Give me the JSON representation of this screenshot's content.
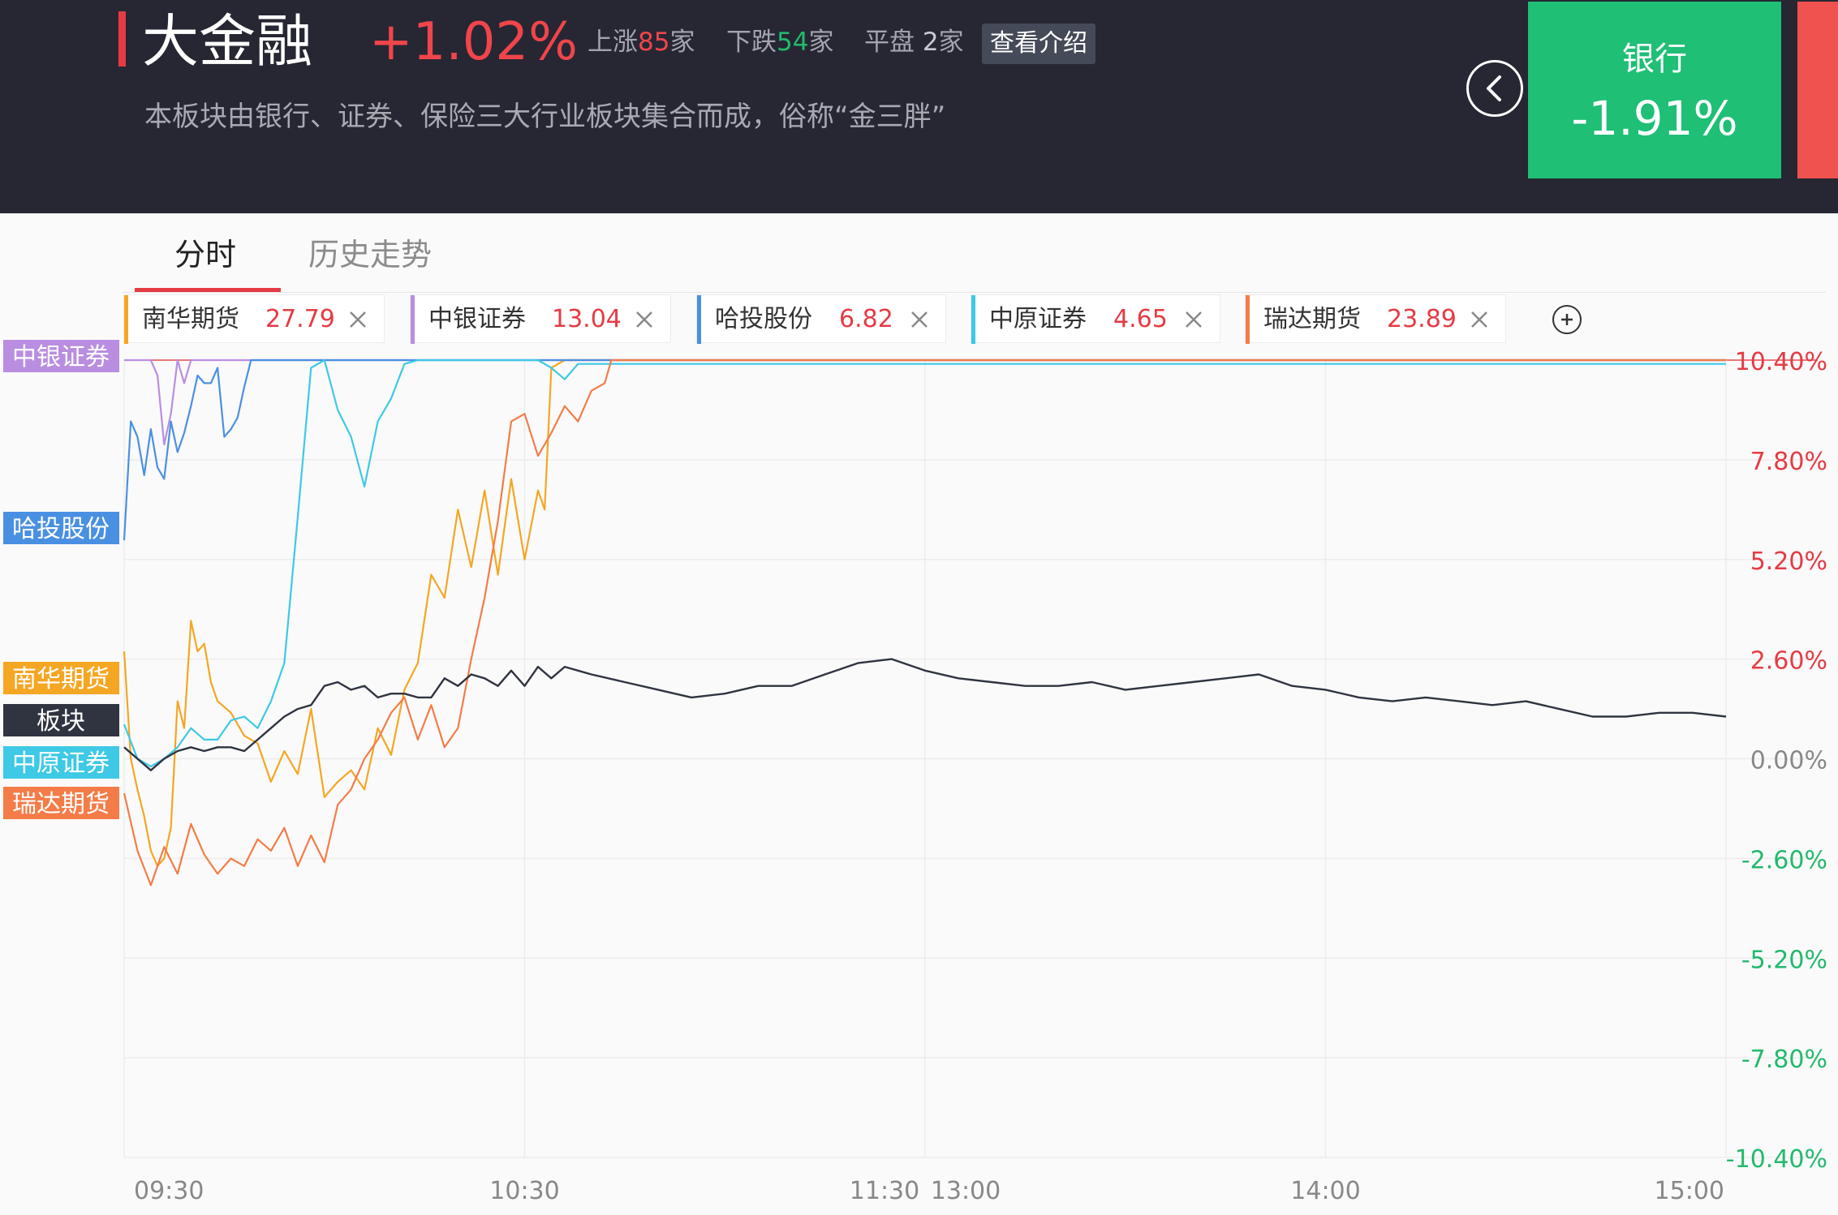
{
  "header": {
    "sector_name": "大金融",
    "sector_change": "+1.02%",
    "up_label": "上涨",
    "up_count": "85",
    "down_label": "下跌",
    "down_count": "54",
    "flat_label": "平盘",
    "flat_count": "2",
    "unit": "家",
    "intro_button": "查看介绍",
    "description": "本板块由银行、证券、保险三大行业板块集合而成，俗称“金三胖”"
  },
  "side_card": {
    "name": "银行",
    "change": "-1.91%"
  },
  "tabs": [
    {
      "label": "分时"
    },
    {
      "label": "历史走势"
    }
  ],
  "chips": [
    {
      "name": "南华期货",
      "value": "27.79",
      "color": "#f5a623"
    },
    {
      "name": "中银证券",
      "value": "13.04",
      "color": "#b98ee0"
    },
    {
      "name": "哈投股份",
      "value": "6.82",
      "color": "#4a90e2"
    },
    {
      "name": "中原证券",
      "value": "4.65",
      "color": "#3ec9e6"
    },
    {
      "name": "瑞达期货",
      "value": "23.89",
      "color": "#f47c48"
    }
  ],
  "colors": {
    "up": "#e53b44",
    "down": "#23b96d",
    "board": "#2f3440",
    "header_bg": "#262733"
  },
  "icons": {
    "back": "chevron-left-icon",
    "close": "close-icon",
    "add": "plus-circle-icon"
  },
  "chart_data": {
    "type": "line",
    "y_unit": "%",
    "ylim": [
      -10.4,
      10.4
    ],
    "y_ticks": [
      10.4,
      7.8,
      5.2,
      2.6,
      0.0,
      -2.6,
      -5.2,
      -7.8,
      -10.4
    ],
    "y_tick_labels": [
      "10.40%",
      "7.80%",
      "5.20%",
      "2.60%",
      "0.00%",
      "-2.60%",
      "-5.20%",
      "-7.80%",
      "-10.40%"
    ],
    "x_tick_labels": [
      "09:30",
      "10:30",
      "11:30",
      "13:00",
      "14:00",
      "15:00"
    ],
    "x_tick_minutes": [
      0,
      60,
      120,
      120,
      180,
      240
    ],
    "x_range": [
      0,
      240
    ],
    "grid": true,
    "series": [
      {
        "name": "南华期货",
        "color": "#f5a623",
        "x": [
          0,
          1,
          2,
          3,
          4,
          5,
          6,
          7,
          8,
          9,
          10,
          11,
          12,
          13,
          14,
          16,
          18,
          20,
          22,
          24,
          26,
          28,
          30,
          32,
          34,
          36,
          38,
          40,
          42,
          44,
          46,
          48,
          50,
          52,
          54,
          56,
          58,
          60,
          62,
          63,
          64,
          66,
          68,
          70,
          72,
          74,
          76,
          78,
          80,
          81,
          82,
          84,
          86,
          90,
          100,
          110,
          120,
          130,
          140,
          150,
          160,
          170,
          180,
          190,
          200,
          210,
          220,
          230,
          240
        ],
        "values": [
          2.8,
          0.0,
          -0.8,
          -1.5,
          -2.4,
          -2.8,
          -2.6,
          -1.8,
          1.5,
          0.8,
          3.6,
          2.8,
          3.0,
          2.0,
          1.5,
          1.2,
          0.6,
          0.4,
          -0.6,
          0.2,
          -0.4,
          1.3,
          -1.0,
          -0.6,
          -0.3,
          -0.8,
          0.8,
          0.1,
          1.8,
          2.5,
          4.8,
          4.2,
          6.5,
          5.0,
          7.0,
          4.8,
          7.3,
          5.2,
          7.0,
          6.5,
          10.2,
          10.4,
          10.4,
          10.4,
          10.4,
          10.4,
          10.4,
          10.4,
          10.4,
          10.4,
          10.4,
          10.4,
          10.4,
          10.4,
          10.4,
          10.4,
          10.4,
          10.4,
          10.4,
          10.4,
          10.4,
          10.4,
          10.4,
          10.4,
          10.4,
          10.4,
          10.4,
          10.4,
          10.4
        ]
      },
      {
        "name": "中银证券",
        "color": "#b98ee0",
        "x": [
          0,
          3,
          4,
          5,
          6,
          7,
          8,
          9,
          10,
          11,
          12,
          13,
          14,
          16,
          20,
          40,
          60,
          80,
          100,
          120,
          140,
          160,
          180,
          200,
          220,
          240
        ],
        "values": [
          10.4,
          10.4,
          10.4,
          10.0,
          8.2,
          9.0,
          10.4,
          9.8,
          10.4,
          10.4,
          10.4,
          10.4,
          10.4,
          10.4,
          10.4,
          10.4,
          10.4,
          10.4,
          10.4,
          10.4,
          10.4,
          10.4,
          10.4,
          10.4,
          10.4,
          10.4
        ]
      },
      {
        "name": "哈投股份",
        "color": "#4a90e2",
        "x": [
          0,
          1,
          2,
          3,
          4,
          5,
          6,
          7,
          8,
          9,
          10,
          11,
          12,
          13,
          14,
          15,
          16,
          17,
          18,
          19,
          20,
          30,
          60,
          90,
          120,
          150,
          180,
          210,
          240
        ],
        "values": [
          5.7,
          8.8,
          8.4,
          7.4,
          8.6,
          7.6,
          7.3,
          8.8,
          8.0,
          8.5,
          9.2,
          10.0,
          9.8,
          9.8,
          10.2,
          8.4,
          8.6,
          8.9,
          9.7,
          10.4,
          10.4,
          10.4,
          10.4,
          10.4,
          10.4,
          10.4,
          10.4,
          10.4,
          10.4
        ]
      },
      {
        "name": "中原证券",
        "color": "#3ec9e6",
        "x": [
          0,
          2,
          4,
          6,
          8,
          10,
          12,
          14,
          16,
          18,
          20,
          22,
          24,
          26,
          28,
          30,
          32,
          34,
          36,
          38,
          40,
          42,
          44,
          46,
          48,
          50,
          52,
          54,
          56,
          58,
          60,
          62,
          64,
          66,
          68,
          70,
          80,
          100,
          120,
          140,
          160,
          180,
          200,
          220,
          240
        ],
        "values": [
          0.9,
          0.0,
          -0.2,
          0.0,
          0.3,
          0.8,
          0.5,
          0.5,
          1.0,
          1.1,
          0.8,
          1.5,
          2.5,
          6.3,
          10.2,
          10.4,
          9.1,
          8.4,
          7.1,
          8.8,
          9.4,
          10.3,
          10.4,
          10.4,
          10.4,
          10.4,
          10.4,
          10.4,
          10.4,
          10.4,
          10.4,
          10.4,
          10.2,
          9.9,
          10.3,
          10.3,
          10.3,
          10.3,
          10.3,
          10.3,
          10.3,
          10.3,
          10.3,
          10.3,
          10.3
        ]
      },
      {
        "name": "瑞达期货",
        "color": "#f47c48",
        "x": [
          0,
          2,
          4,
          6,
          8,
          10,
          12,
          14,
          16,
          18,
          20,
          22,
          24,
          26,
          28,
          30,
          32,
          34,
          36,
          38,
          40,
          42,
          44,
          46,
          48,
          50,
          52,
          54,
          56,
          58,
          60,
          62,
          64,
          66,
          68,
          70,
          72,
          73,
          80,
          100,
          120,
          140,
          160,
          180,
          200,
          220,
          240
        ],
        "values": [
          -0.9,
          -2.4,
          -3.3,
          -2.3,
          -3.0,
          -1.7,
          -2.5,
          -3.0,
          -2.6,
          -2.8,
          -2.1,
          -2.4,
          -1.8,
          -2.8,
          -2.0,
          -2.7,
          -1.2,
          -0.8,
          0.0,
          0.5,
          1.2,
          1.6,
          0.5,
          1.4,
          0.3,
          0.8,
          2.6,
          4.2,
          6.2,
          8.8,
          9.0,
          7.9,
          8.5,
          9.2,
          8.8,
          9.6,
          9.8,
          10.4,
          10.4,
          10.4,
          10.4,
          10.4,
          10.4,
          10.4,
          10.4,
          10.4,
          10.4
        ]
      },
      {
        "name": "板块",
        "color": "#2f3440",
        "x": [
          0,
          2,
          4,
          6,
          8,
          10,
          12,
          14,
          16,
          18,
          20,
          22,
          24,
          26,
          28,
          30,
          32,
          34,
          36,
          38,
          40,
          42,
          44,
          46,
          48,
          50,
          52,
          54,
          56,
          58,
          60,
          62,
          64,
          66,
          68,
          70,
          75,
          80,
          85,
          90,
          95,
          100,
          105,
          110,
          115,
          120,
          125,
          130,
          135,
          140,
          145,
          150,
          155,
          160,
          165,
          170,
          175,
          180,
          185,
          190,
          195,
          200,
          205,
          210,
          215,
          220,
          225,
          230,
          235,
          240
        ],
        "values": [
          0.3,
          0.0,
          -0.3,
          0.0,
          0.2,
          0.3,
          0.2,
          0.3,
          0.3,
          0.2,
          0.5,
          0.8,
          1.1,
          1.3,
          1.4,
          1.9,
          2.0,
          1.8,
          1.9,
          1.6,
          1.7,
          1.7,
          1.6,
          1.6,
          2.1,
          1.9,
          2.2,
          2.1,
          1.9,
          2.3,
          1.9,
          2.4,
          2.1,
          2.4,
          2.3,
          2.2,
          2.0,
          1.8,
          1.6,
          1.7,
          1.9,
          1.9,
          2.2,
          2.5,
          2.6,
          2.3,
          2.1,
          2.0,
          1.9,
          1.9,
          2.0,
          1.8,
          1.9,
          2.0,
          2.1,
          2.2,
          1.9,
          1.8,
          1.6,
          1.5,
          1.6,
          1.5,
          1.4,
          1.5,
          1.3,
          1.1,
          1.1,
          1.2,
          1.2,
          1.1
        ]
      }
    ]
  }
}
